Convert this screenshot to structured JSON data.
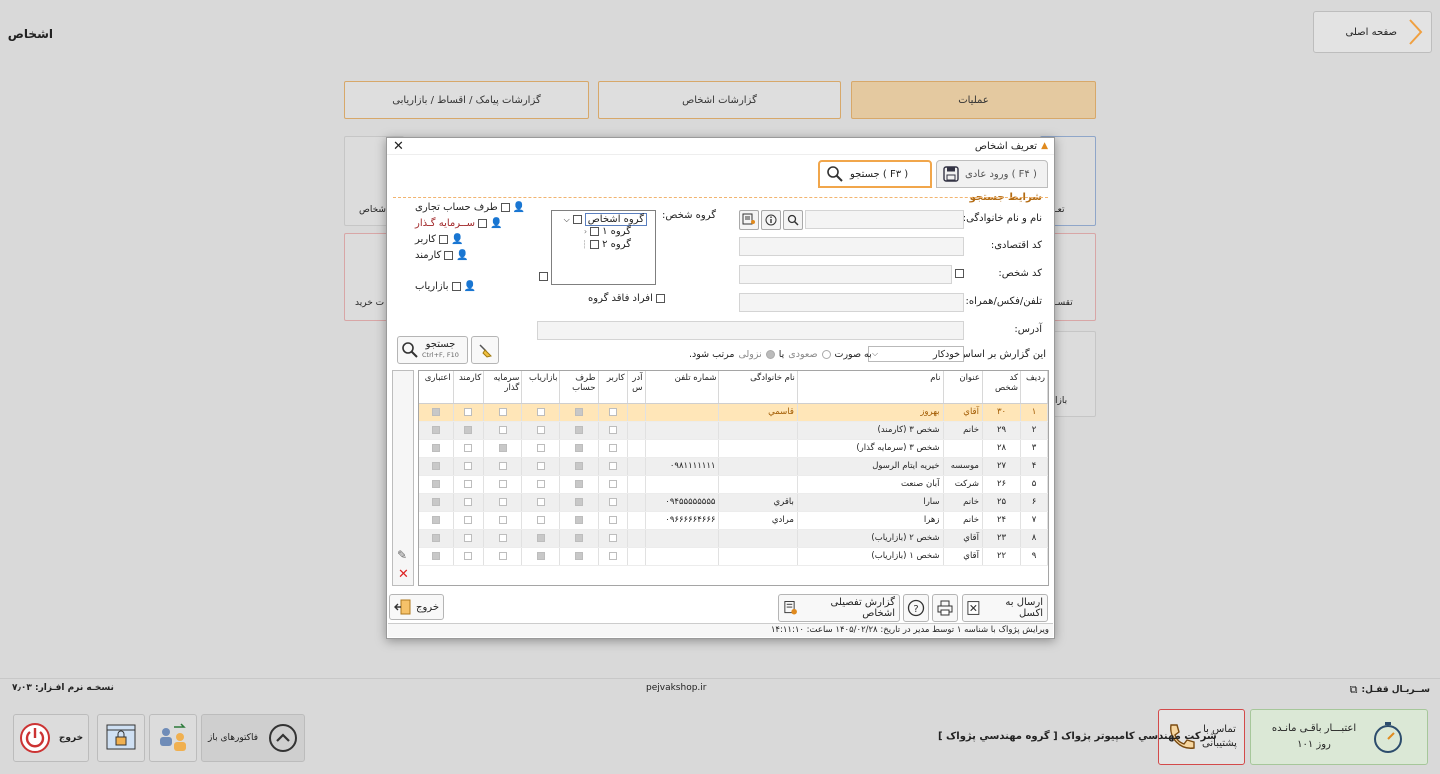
{
  "app": {
    "title": "اشخاص",
    "home_label": "صفحه اصلی"
  },
  "tabs": {
    "ops": "عملیات",
    "persons_reports": "گزارشات اشخاص",
    "sms_reports": "گزارشات پیامک / اقساط / بازاریابی"
  },
  "bg_cards": {
    "card1": "تعـ",
    "card2": "اشخاص",
    "card3": "تقسـ",
    "card4": "ت خرید",
    "card5": "بازا"
  },
  "modal": {
    "title": "تعریف اشخاص",
    "tab_normal": "ورود عادی ( F۴ )",
    "tab_search": "جستجو ( F۳ )",
    "section": "شرایط جستجو",
    "labels": {
      "name": "نام و نام خانوادگی:",
      "eco": "کد اقتصادی:",
      "code": "کد شخص:",
      "phone": "تلفن/فکس/همراه:",
      "addr": "آدرس:",
      "group": "گروه شخص:",
      "report": "این گزارش بر اساس:",
      "order_as": "به صورت",
      "asc": "صعودی",
      "or": "یا",
      "desc": "نزولی",
      "sorted": "مرتب شود."
    },
    "report_select": "خودکار",
    "tree": {
      "root": "گروه اشخاص",
      "g1": "گروه ۱",
      "g2": "گروه ۲"
    },
    "no_group": "افراد فاقد گروه",
    "checks": {
      "trade": "طرف حساب تجاری",
      "investor": "ســرمایه گـذار",
      "user": "کاربر",
      "employee": "کارمند",
      "marketer": "بازاریاب"
    },
    "search_btn": "جستجو",
    "search_hint": "Ctrl+F, F10",
    "columns": [
      "ردیف",
      "کد شخص",
      "عنوان",
      "نام",
      "نام خانوادگی",
      "شماره تلفن",
      "آدر س",
      "کاربر",
      "طرف حساب",
      "بازاریاب",
      "سرمایه گذار",
      "کارمند",
      "اعتباری"
    ],
    "rows": [
      {
        "r": "۱",
        "code": "۳۰",
        "title": "آقاي",
        "name": "بهروز",
        "family": "قاسمي",
        "phone": "",
        "flags": [
          0,
          1,
          0,
          0,
          0,
          1
        ]
      },
      {
        "r": "۲",
        "code": "۲۹",
        "title": "خانم",
        "name": "شخص ۳ (کارمند)",
        "family": "",
        "phone": "",
        "flags": [
          0,
          1,
          0,
          0,
          1,
          1
        ]
      },
      {
        "r": "۳",
        "code": "۲۸",
        "title": "",
        "name": "شخص ۳ (سرمايه گذار)",
        "family": "",
        "phone": "",
        "flags": [
          0,
          1,
          0,
          1,
          0,
          1
        ]
      },
      {
        "r": "۴",
        "code": "۲۷",
        "title": "موسسه",
        "name": "خيريه ايتام الرسول",
        "family": "",
        "phone": "۰۹۸۱۱۱۱۱۱۱",
        "flags": [
          0,
          1,
          0,
          0,
          0,
          1
        ]
      },
      {
        "r": "۵",
        "code": "۲۶",
        "title": "شرکت",
        "name": "آبان صنعت",
        "family": "",
        "phone": "",
        "flags": [
          0,
          1,
          0,
          0,
          0,
          1
        ]
      },
      {
        "r": "۶",
        "code": "۲۵",
        "title": "خانم",
        "name": "سارا",
        "family": "باقري",
        "phone": "۰۹۴۵۵۵۵۵۵۵۵",
        "flags": [
          0,
          1,
          0,
          0,
          0,
          1
        ]
      },
      {
        "r": "۷",
        "code": "۲۴",
        "title": "خانم",
        "name": "زهرا",
        "family": "مرادي",
        "phone": "۰۹۶۶۶۶۶۴۶۶۶",
        "flags": [
          0,
          1,
          0,
          0,
          0,
          1
        ]
      },
      {
        "r": "۸",
        "code": "۲۳",
        "title": "آقاي",
        "name": "شخص ۲ (بازاریاب)",
        "family": "",
        "phone": "",
        "flags": [
          0,
          1,
          1,
          0,
          0,
          1
        ]
      },
      {
        "r": "۹",
        "code": "۲۲",
        "title": "آقاي",
        "name": "شخص ۱ (بازاریاب)",
        "family": "",
        "phone": "",
        "flags": [
          0,
          1,
          1,
          0,
          0,
          1
        ]
      }
    ],
    "excel_btn": "ارسال به اکسل",
    "detail_btn": "گزارش تفصیلی اشخاص",
    "exit_btn": "خروج",
    "status": "ويرايش  پژواک  با شناسه ۱ توسط مدير در تاریخ: ۱۴۰۵/۰۲/۲۸ ساعت: ۱۴:۱۱:۱۰"
  },
  "status_bar": {
    "serial": "ســریـال قفـل:",
    "site": "pejvakshop.ir",
    "version": "نسخـه نرم افـزار: ۷٫۰۳"
  },
  "dock": {
    "credit": "اعتبـــار باقـی مانـده",
    "credit_days": "۱۰۱ روز",
    "support": "تماس با پشتیبانی",
    "company": "شرکت مهندسي کامپيوتر پژواک [ گروه مهندسي پژواک ]",
    "open_invoices": "فاکتورهای باز",
    "exit": "خروج"
  }
}
